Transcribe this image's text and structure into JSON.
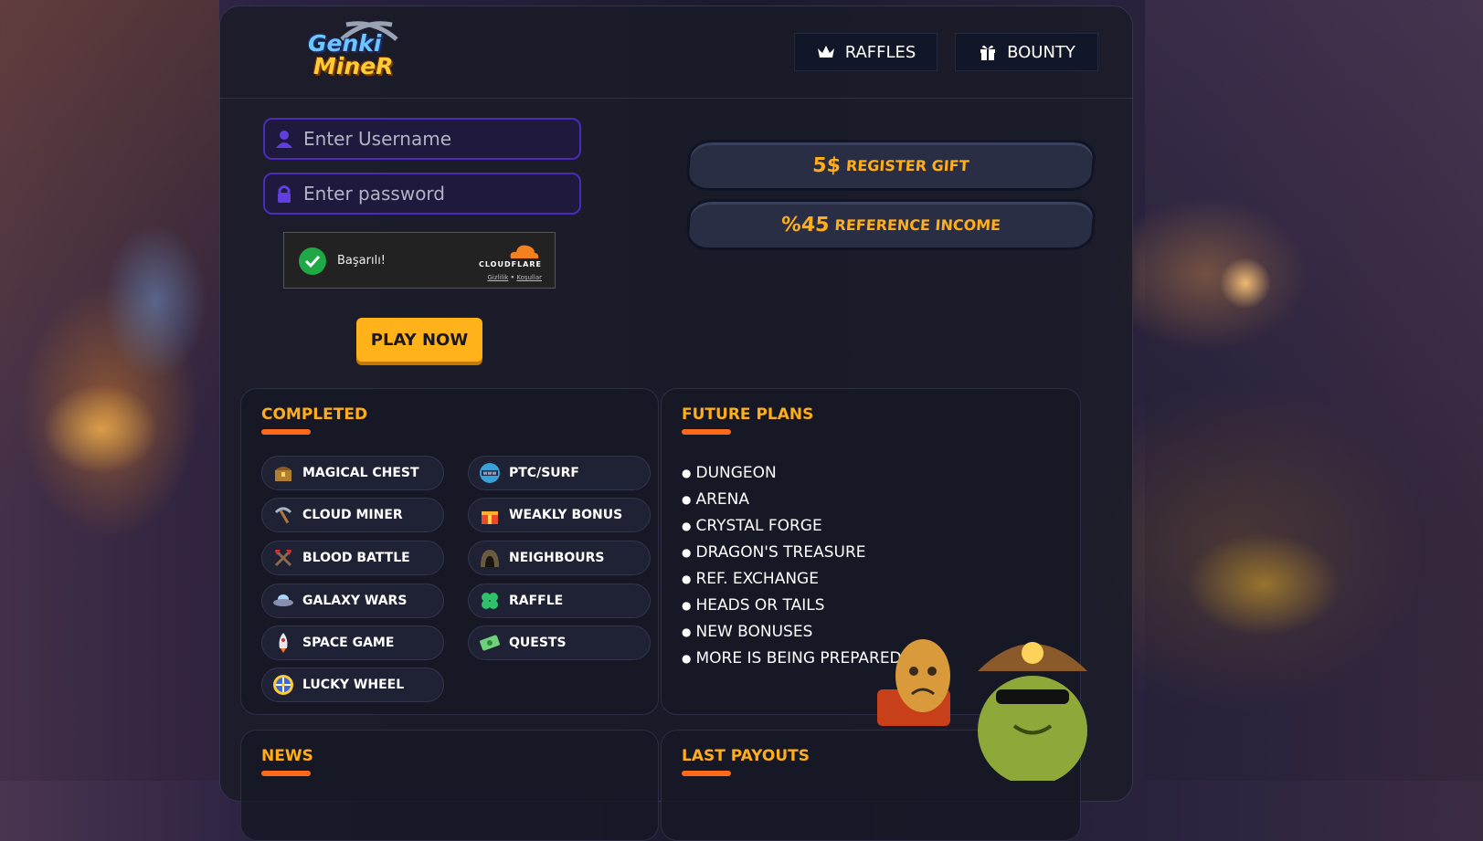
{
  "header": {
    "logo": {
      "line1": "Genki",
      "line2": "MineR"
    },
    "raffles_label": "RAFFLES",
    "bounty_label": "BOUNTY"
  },
  "login": {
    "username_placeholder": "Enter Username",
    "password_placeholder": "Enter password",
    "captcha": {
      "status": "Başarılı!",
      "brand": "CLOUDFLARE",
      "privacy": "Gizlilik",
      "separator": "•",
      "terms": "Koşullar"
    },
    "play_label": "PLAY NOW"
  },
  "promos": [
    {
      "big": "5$",
      "small": "REGISTER GIFT"
    },
    {
      "big": "%45",
      "small": "REFERENCE INCOME"
    }
  ],
  "completed": {
    "title": "COMPLETED",
    "items": [
      {
        "label": "MAGICAL CHEST",
        "icon": "chest-icon"
      },
      {
        "label": "PTC/SURF",
        "icon": "www-globe-icon"
      },
      {
        "label": "CLOUD MINER",
        "icon": "pickaxe-icon"
      },
      {
        "label": "WEAKLY BONUS",
        "icon": "gift-icon"
      },
      {
        "label": "BLOOD BATTLE",
        "icon": "crossed-axes-icon"
      },
      {
        "label": "NEIGHBOURS",
        "icon": "mine-entrance-icon"
      },
      {
        "label": "GALAXY WARS",
        "icon": "ufo-icon"
      },
      {
        "label": "RAFFLE",
        "icon": "clover-icon"
      },
      {
        "label": "SPACE GAME",
        "icon": "rocket-icon"
      },
      {
        "label": "QUESTS",
        "icon": "money-bill-icon"
      },
      {
        "label": "LUCKY WHEEL",
        "icon": "wheel-icon"
      }
    ]
  },
  "future": {
    "title": "FUTURE PLANS",
    "items": [
      "DUNGEON",
      "ARENA",
      "CRYSTAL FORGE",
      "DRAGON'S TREASURE",
      "REF. EXCHANGE",
      "HEADS OR TAILS",
      "NEW BONUSES",
      "MORE IS BEING PREPARED!"
    ]
  },
  "news": {
    "title": "NEWS"
  },
  "payouts": {
    "title": "LAST PAYOUTS"
  },
  "colors": {
    "accent": "#ffae1a",
    "underline": "#ff6a1a",
    "field_border": "#4b2cb8",
    "panel": "#1a1b28"
  }
}
